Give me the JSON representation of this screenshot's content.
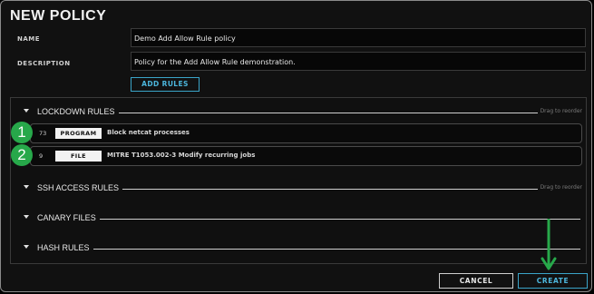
{
  "dialog": {
    "title": "NEW POLICY",
    "name_label": "NAME",
    "name_value": "Demo Add Allow Rule policy",
    "description_label": "DESCRIPTION",
    "description_value": "Policy for the Add Allow Rule demonstration.",
    "add_rules_label": "ADD RULES"
  },
  "sections": {
    "lockdown": {
      "label": "LOCKDOWN RULES",
      "hint": "Drag to reorder",
      "rules": [
        {
          "count": "73",
          "type": "PROGRAM",
          "name": "Block netcat processes",
          "badge": "1"
        },
        {
          "count": "9",
          "type": "FILE",
          "name": "MITRE T1053.002-3 Modify recurring jobs",
          "badge": "2"
        }
      ]
    },
    "ssh": {
      "label": "SSH ACCESS RULES",
      "hint": "Drag to reorder"
    },
    "canary": {
      "label": "CANARY FILES"
    },
    "hash": {
      "label": "HASH RULES"
    }
  },
  "footer": {
    "cancel_label": "CANCEL",
    "create_label": "CREATE"
  },
  "colors": {
    "accent": "#3aa4c8",
    "annotation": "#27a84a"
  },
  "icons": {
    "caret": "caret-down-icon",
    "arrow": "arrow-down-icon"
  }
}
